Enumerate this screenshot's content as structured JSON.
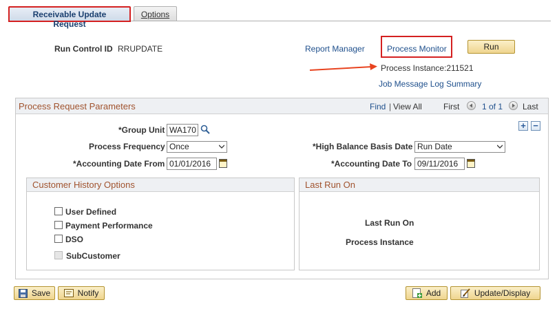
{
  "tabs": [
    {
      "label": "Receivable Update Request"
    },
    {
      "label": "Options"
    }
  ],
  "header": {
    "run_control_label": "Run Control ID",
    "run_control_value": "RRUPDATE",
    "report_manager": "Report Manager",
    "process_monitor": "Process Monitor",
    "run_label": "Run",
    "process_instance": "Process Instance:211521",
    "job_message_log": "Job Message Log Summary"
  },
  "params": {
    "title": "Process Request Parameters",
    "find": "Find",
    "separator": "|",
    "view_all": "View All",
    "first": "First",
    "range": "1 of 1",
    "last": "Last",
    "group_unit_label": "*Group Unit",
    "group_unit_value": "WA170",
    "frequency_label": "Process Frequency",
    "frequency_value": "Once",
    "high_balance_label": "*High Balance Basis Date",
    "high_balance_value": "Run Date",
    "acct_from_label": "*Accounting Date From",
    "acct_from_value": "01/01/2016",
    "acct_to_label": "*Accounting Date To",
    "acct_to_value": "09/11/2016"
  },
  "customer_history": {
    "title": "Customer History Options",
    "options": [
      {
        "label": "User Defined",
        "checked": false,
        "disabled": false
      },
      {
        "label": "Payment Performance",
        "checked": false,
        "disabled": false
      },
      {
        "label": "DSO",
        "checked": false,
        "disabled": false
      },
      {
        "label": "SubCustomer",
        "checked": false,
        "disabled": true
      }
    ]
  },
  "last_run": {
    "title": "Last Run On",
    "last_run_label": "Last Run On",
    "process_instance_label": "Process Instance"
  },
  "footer": {
    "save": "Save",
    "notify": "Notify",
    "add": "Add",
    "update_display": "Update/Display"
  },
  "colors": {
    "highlight": "#d42020",
    "link": "#1e4f8c",
    "section_title": "#a0522d",
    "button_bg": "#efd58f"
  }
}
